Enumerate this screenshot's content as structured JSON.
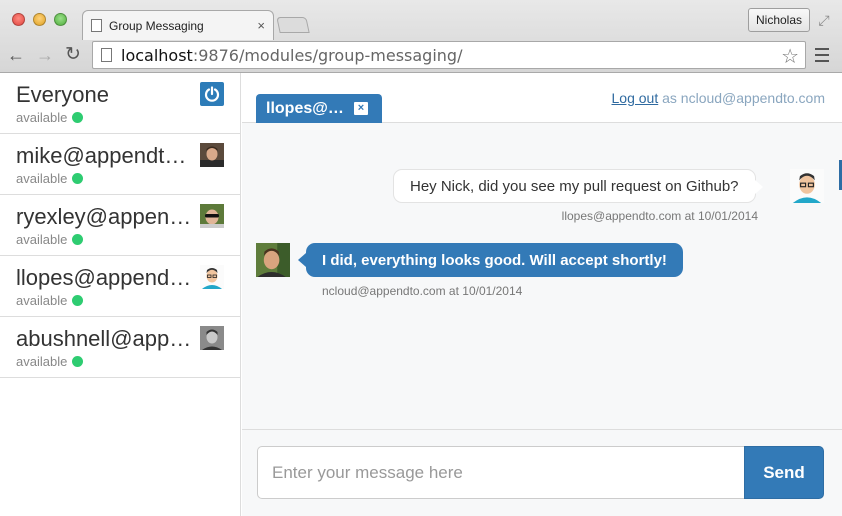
{
  "browser": {
    "tab_title": "Group Messaging",
    "tab_close": "×",
    "profile_name": "Nicholas",
    "url_host": "localhost",
    "url_path": ":9876/modules/group-messaging/",
    "icons": {
      "back": "back-arrow-icon",
      "forward": "forward-arrow-icon",
      "reload": "reload-icon",
      "star": "bookmark-star-icon",
      "menu": "hamburger-menu-icon"
    }
  },
  "sidebar": {
    "contacts": [
      {
        "name": "Everyone",
        "status": "available",
        "avatar": "power-icon"
      },
      {
        "name": "mike@appendto.com",
        "status": "available",
        "avatar": "avatar-mike"
      },
      {
        "name": "ryexley@appendto.com",
        "status": "available",
        "avatar": "avatar-ryexley"
      },
      {
        "name": "llopes@appendto.com",
        "status": "available",
        "avatar": "avatar-llopes"
      },
      {
        "name": "abushnell@appendto.com",
        "status": "available",
        "avatar": "avatar-abushnell"
      }
    ],
    "status_color": "#2ecc71"
  },
  "chat": {
    "tab_label": "llopes@appendto.com",
    "tab_close": "×",
    "session": {
      "logout_label": "Log out",
      "as_text": "as ncloud@appendto.com"
    },
    "messages": [
      {
        "direction": "incoming",
        "text": "Hey Nick, did you see my pull request on Github?",
        "meta": "llopes@appendto.com at 10/01/2014"
      },
      {
        "direction": "outgoing",
        "text": "I did, everything looks good. Will accept shortly!",
        "meta": "ncloud@appendto.com at 10/01/2014"
      }
    ],
    "composer": {
      "placeholder": "Enter your message here",
      "send_label": "Send"
    },
    "accent_color": "#337ab7"
  }
}
